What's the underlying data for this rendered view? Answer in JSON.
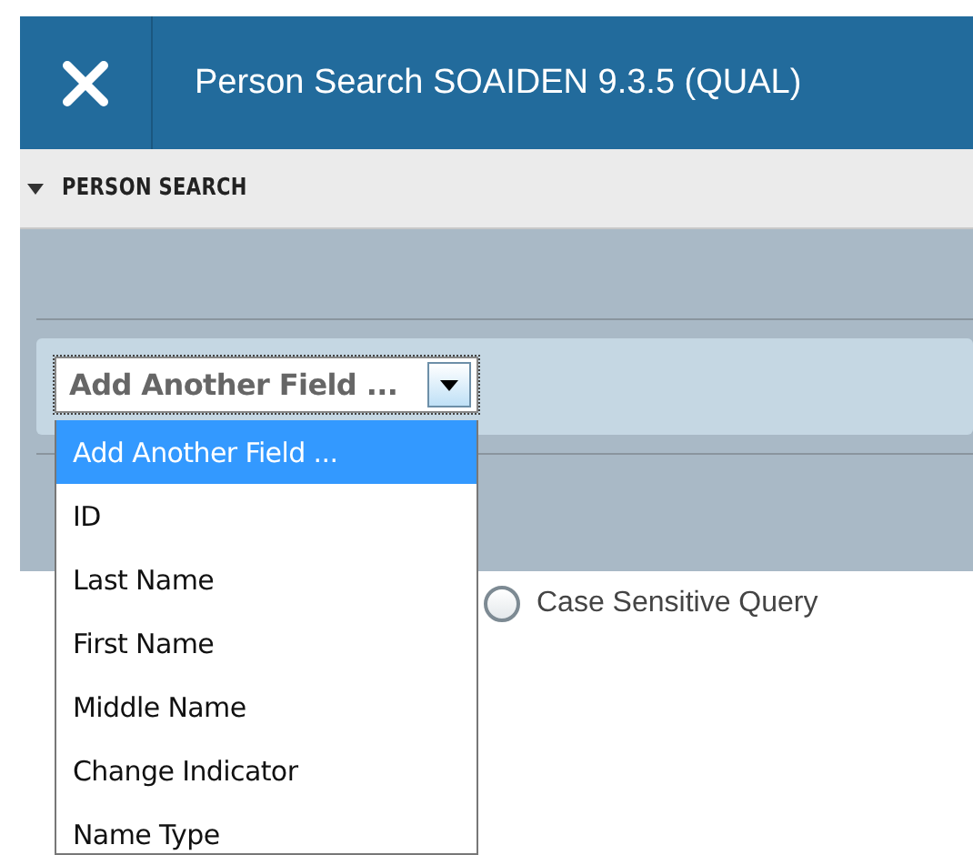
{
  "window": {
    "title": "Person Search SOAIDEN 9.3.5 (QUAL)"
  },
  "section": {
    "title": "PERSON SEARCH",
    "expanded": true
  },
  "field_select": {
    "value": "Add Another Field ...",
    "expanded": true,
    "options": [
      {
        "label": "Add Another Field ...",
        "selected": true
      },
      {
        "label": "ID",
        "selected": false
      },
      {
        "label": "Last Name",
        "selected": false
      },
      {
        "label": "First Name",
        "selected": false
      },
      {
        "label": "Middle Name",
        "selected": false
      },
      {
        "label": "Change Indicator",
        "selected": false
      },
      {
        "label": "Name Type",
        "selected": false
      }
    ]
  },
  "options": [
    {
      "label": "Case Sensitive Query",
      "selected": false
    }
  ]
}
